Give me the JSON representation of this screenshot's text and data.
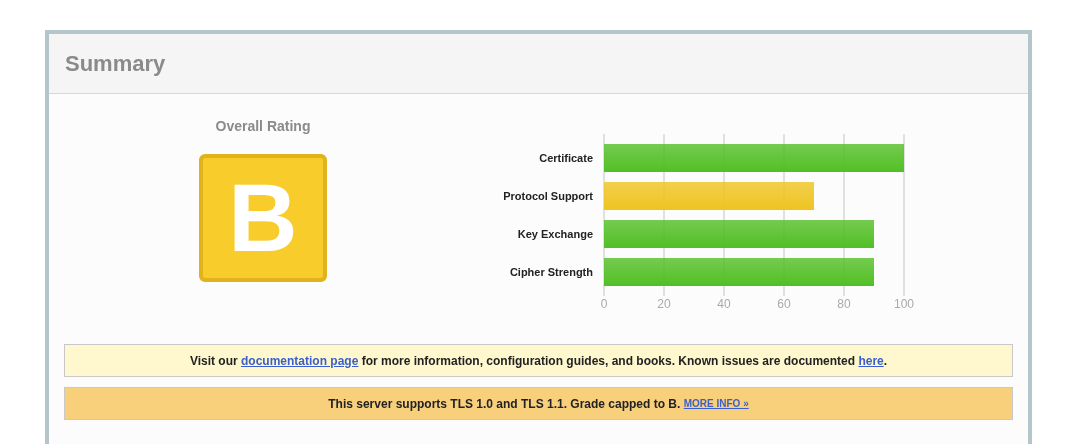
{
  "summary": {
    "title": "Summary",
    "overall_rating": {
      "label": "Overall Rating",
      "grade": "B",
      "color": "#f8cc2a"
    },
    "chart_data": {
      "type": "bar",
      "orientation": "horizontal",
      "categories": [
        "Certificate",
        "Protocol Support",
        "Key Exchange",
        "Cipher Strength"
      ],
      "values": [
        100,
        70,
        90,
        90
      ],
      "grid": true,
      "colors": [
        "#52bf25",
        "#efc421",
        "#52bf25",
        "#52bf25"
      ],
      "xlim": [
        0,
        100
      ],
      "xticks": [
        0,
        20,
        40,
        60,
        80,
        100
      ]
    },
    "notices": [
      {
        "kind": "info",
        "segments": [
          {
            "kind": "text",
            "text": "Visit our "
          },
          {
            "kind": "link",
            "text": "documentation page"
          },
          {
            "kind": "text",
            "text": " for more information, configuration guides, and books. Known issues are documented "
          },
          {
            "kind": "link",
            "text": "here"
          },
          {
            "kind": "text",
            "text": "."
          }
        ]
      },
      {
        "kind": "warning",
        "segments": [
          {
            "kind": "text",
            "text": "This server supports TLS 1.0 and TLS 1.1. Grade capped to B. "
          },
          {
            "kind": "small_link",
            "text": "MORE INFO »"
          }
        ]
      }
    ]
  }
}
